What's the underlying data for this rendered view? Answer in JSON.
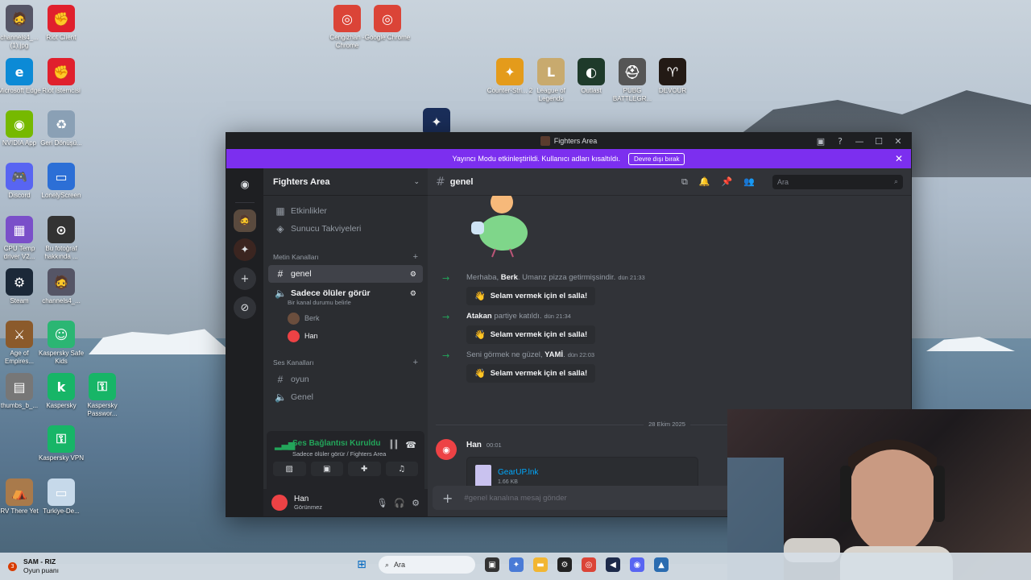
{
  "desktop": {
    "icons": [
      {
        "label": "channels4_...(1).jpg",
        "glyph": "🧔",
        "color": "#556"
      },
      {
        "label": "Riot Client",
        "glyph": "✊",
        "color": "#e0202d"
      },
      {
        "label": "Microsoft Edge",
        "glyph": "e",
        "color": "#0c8ad6"
      },
      {
        "label": "Riot İstemcisi",
        "glyph": "✊",
        "color": "#e0202d"
      },
      {
        "label": "NVIDIA App",
        "glyph": "◉",
        "color": "#76b900"
      },
      {
        "label": "Geri Dönüşü...",
        "glyph": "♻",
        "color": "#8aa0b5"
      },
      {
        "label": "Discord",
        "glyph": "🎮",
        "color": "#5865f2"
      },
      {
        "label": "LonelyScreen",
        "glyph": "▭",
        "color": "#2c6fd6"
      },
      {
        "label": "CPU Temp driver V2...",
        "glyph": "▦",
        "color": "#7a4fc9"
      },
      {
        "label": "Bu fotoğraf hakkında ...",
        "glyph": "⊙",
        "color": "#333"
      },
      {
        "label": "Steam",
        "glyph": "⚙",
        "color": "#1b2838"
      },
      {
        "label": "channels4_...",
        "glyph": "🧔",
        "color": "#556"
      },
      {
        "label": "Age of Empires...",
        "glyph": "⚔",
        "color": "#8b5a2b"
      },
      {
        "label": "Kaspersky Safe Kids",
        "glyph": "☺",
        "color": "#2bb673"
      },
      {
        "label": "thumbs_b_...",
        "glyph": "▤",
        "color": "#777"
      },
      {
        "label": "Kaspersky",
        "glyph": "k",
        "color": "#17b567"
      },
      {
        "label": "Kaspersky Passwor...",
        "glyph": "⚿",
        "color": "#17b567"
      },
      {
        "label": "Kaspersky VPN",
        "glyph": "⚿",
        "color": "#17b567"
      },
      {
        "label": "RV There Yet",
        "glyph": "⛺",
        "color": "#a97a4b"
      },
      {
        "label": "Turkiye-De...",
        "glyph": "▭",
        "color": "#c6d9ea"
      },
      {
        "label": "Cengizhan - Chrome",
        "glyph": "◎",
        "color": "#db4437"
      },
      {
        "label": "Google Chrome",
        "glyph": "◎",
        "color": "#db4437"
      },
      {
        "label": "Counter-Stri... 2",
        "glyph": "✦",
        "color": "#e49b1b"
      },
      {
        "label": "League of Legends",
        "glyph": "L",
        "color": "#c8aa6e"
      },
      {
        "label": "Outlast",
        "glyph": "◐",
        "color": "#1e3a2a"
      },
      {
        "label": "PUBG BATTLEGR...",
        "glyph": "⛑",
        "color": "#555"
      },
      {
        "label": "DEVOUR",
        "glyph": "♈",
        "color": "#231a15"
      }
    ]
  },
  "window": {
    "title": "Fighters Area",
    "banner_text": "Yayıncı Modu etkinleştirildi. Kullanıcı adları kısaltıldı.",
    "banner_button": "Devre dışı bırak"
  },
  "guild": {
    "name": "Fighters Area",
    "top_items": [
      {
        "label": "Etkinlikler",
        "icon": "calendar-icon",
        "glyph": "▦"
      },
      {
        "label": "Sunucu Takviyeleri",
        "icon": "boost-icon",
        "glyph": "◈"
      }
    ],
    "text_category": "Metin Kanalları",
    "text_channels": [
      {
        "label": "genel",
        "glyph": "#",
        "active": true
      },
      {
        "label": "Sadece ölüler görür",
        "glyph": "🔊",
        "status": "Bir kanal durumu belirle"
      }
    ],
    "voice_users": [
      {
        "name": "Berk",
        "color": "#6b4e3d"
      },
      {
        "name": "Han",
        "color": "#ed4245"
      }
    ],
    "voice_category": "Ses Kanalları",
    "voice_channels": [
      {
        "label": "oyun",
        "glyph": "#"
      },
      {
        "label": "Genel",
        "glyph": "🔊"
      }
    ]
  },
  "voice_panel": {
    "title": "Ses Bağlantısı Kuruldu",
    "subtitle": "Sadece ölüler görür / Fighters Area"
  },
  "user": {
    "name": "Han",
    "status": "Görünmez"
  },
  "channel": {
    "name": "genel",
    "search_placeholder": "Ara",
    "composer_placeholder": "#genel kanalına mesaj gönder"
  },
  "messages": {
    "system": [
      {
        "pre": "Merhaba, ",
        "user": "Berk",
        "post": ". Umarız pizza getirmişsindir.",
        "time": "dün 21:33",
        "wave": "Selam vermek için el salla!"
      },
      {
        "pre": "",
        "user": "Atakan",
        "post": " partiye katıldı.",
        "time": "dün 21:34",
        "wave": "Selam vermek için el salla!"
      },
      {
        "pre": "Seni görmek ne güzel, ",
        "user": "YAMİ",
        "post": ".",
        "time": "dün 22:03",
        "wave": "Selam vermek için el salla!"
      }
    ],
    "date_divider": "28 Ekim 2025",
    "last": {
      "author": "Han",
      "time": "00:01",
      "file_name": "GearUP.lnk",
      "file_size": "1.66 KB"
    }
  },
  "taskbar": {
    "notif_count": "3",
    "notif_title": "SAM - RIZ",
    "notif_sub": "Oyun puanı",
    "search": "Ara"
  }
}
